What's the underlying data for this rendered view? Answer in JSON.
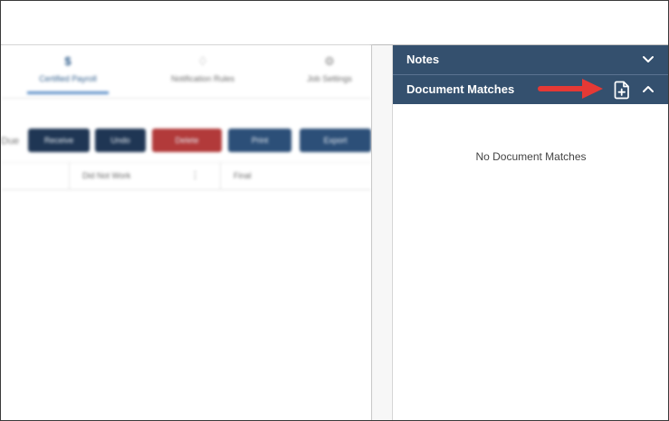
{
  "tabs": [
    {
      "label": "Certified Payroll",
      "icon": "dollar-icon"
    },
    {
      "label": "Notification Rules",
      "icon": "bell-icon"
    },
    {
      "label": "Job Settings",
      "icon": "gear-icon"
    }
  ],
  "toolbar": {
    "due_label": "Due",
    "receive_label": "Receive",
    "undo_label": "Undo",
    "delete_label": "Delete",
    "print_label": "Print",
    "export_label": "Export"
  },
  "grid": {
    "columns": [
      "",
      "Did Not Work",
      "Final"
    ]
  },
  "panel": {
    "notes_label": "Notes",
    "document_matches_label": "Document Matches",
    "empty_message": "No Document Matches"
  },
  "colors": {
    "panel_header": "#34506e",
    "annotation_arrow": "#e53935"
  }
}
